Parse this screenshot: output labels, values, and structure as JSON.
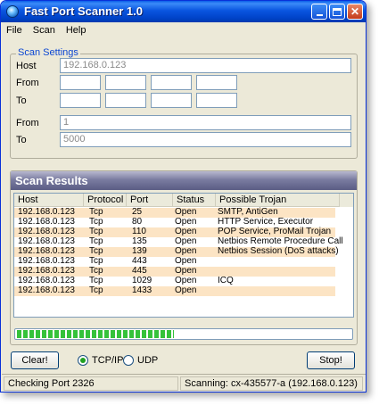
{
  "window": {
    "title": "Fast Port Scanner 1.0"
  },
  "menu": [
    "File",
    "Scan",
    "Help"
  ],
  "settings": {
    "group_title": "Scan Settings",
    "host_label": "Host",
    "host_value": "192.168.0.123",
    "ip_from_label": "From",
    "ip_to_label": "To",
    "ip_from_values": [
      "",
      "",
      "",
      ""
    ],
    "ip_to_values": [
      "",
      "",
      "",
      ""
    ],
    "port_from_label": "From",
    "port_from_value": "1",
    "port_to_label": "To",
    "port_to_value": "5000"
  },
  "results": {
    "title": "Scan Results",
    "columns": [
      "Host",
      "Protocol",
      "Port",
      "Status",
      "Possible Trojan"
    ],
    "rows": [
      [
        "192.168.0.123",
        "Tcp",
        "25",
        "Open",
        "SMTP, AntiGen"
      ],
      [
        "192.168.0.123",
        "Tcp",
        "80",
        "Open",
        "HTTP Service, Executor"
      ],
      [
        "192.168.0.123",
        "Tcp",
        "110",
        "Open",
        "POP Service, ProMail Trojan"
      ],
      [
        "192.168.0.123",
        "Tcp",
        "135",
        "Open",
        "Netbios Remote Procedure Call"
      ],
      [
        "192.168.0.123",
        "Tcp",
        "139",
        "Open",
        "Netbios Session (DoS attacks)"
      ],
      [
        "192.168.0.123",
        "Tcp",
        "443",
        "Open",
        ""
      ],
      [
        "192.168.0.123",
        "Tcp",
        "445",
        "Open",
        ""
      ],
      [
        "192.168.0.123",
        "Tcp",
        "1029",
        "Open",
        "ICQ"
      ],
      [
        "192.168.0.123",
        "Tcp",
        "1433",
        "Open",
        ""
      ]
    ],
    "row_highlight_color": "#fce4c4"
  },
  "progress": {
    "fraction": 0.47,
    "color": "#35c23a"
  },
  "controls": {
    "clear_label": "Clear!",
    "tcp_label": "TCP/IP",
    "udp_label": "UDP",
    "tcp_selected": true,
    "stop_label": "Stop!"
  },
  "status": {
    "left": "Checking Port 2326",
    "right": "Scanning: cx-435577-a (192.168.0.123)"
  },
  "colors": {
    "titlebar": "#0a55e0",
    "group_title": "#0b46d3",
    "results_header": "#7a7ca0",
    "window_bg": "#ece9d8"
  }
}
